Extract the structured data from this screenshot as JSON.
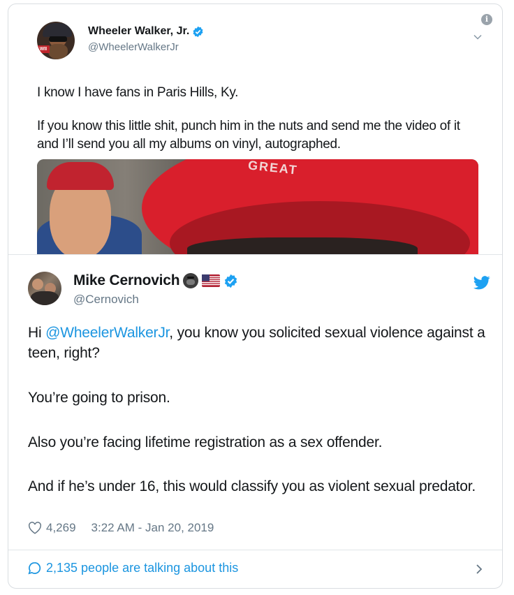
{
  "quoted_tweet": {
    "avatar_badge": "WII",
    "display_name": "Wheeler Walker, Jr.",
    "handle": "@WheelerWalkerJr",
    "info_icon": "info-icon",
    "text_line1": "I know I have fans in Paris Hills, Ky.",
    "text_line2": "If you know this little shit, punch him in the nuts and send me the video of it and I’ll send you all my albums on vinyl, autographed.",
    "media_caption_fragment": "GREAT"
  },
  "main_tweet": {
    "display_name": "Mike Cernovich",
    "handle": "@Cernovich",
    "body_intro": "Hi ",
    "mention": "@WheelerWalkerJr",
    "body_rest": ", you know you solicited sexual violence against a teen, right?",
    "body_2": "You’re going to prison.",
    "body_3": "Also you’re facing lifetime registration as a sex offender.",
    "body_4": "And if he’s under 16, this would classify you as violent sexual predator.",
    "likes": "4,269",
    "timestamp": "3:22 AM - Jan 20, 2019",
    "talking": "2,135 people are talking about this"
  },
  "colors": {
    "link": "#1b95e0",
    "secondary_text": "#657786",
    "verified": "#1da1f2"
  }
}
